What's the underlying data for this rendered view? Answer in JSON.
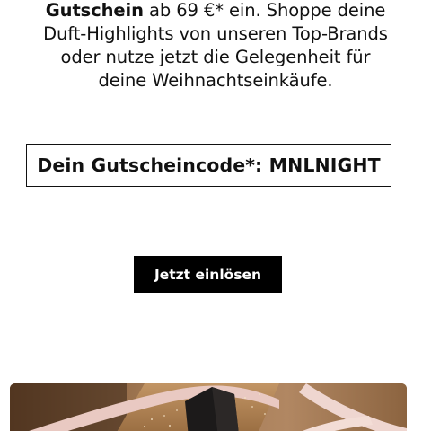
{
  "promo_text": {
    "line1_bold": "Gutschein",
    "line1_rest": " ab 69 €* ein. Shoppe deine",
    "line2": "Duft-Highlights von unseren Top-Brands",
    "line3": "oder nutze jetzt die Gelegenheit für",
    "line4": "deine Weihnachtseinkäufe."
  },
  "voucher": {
    "code_text": "Dein Gutscheincode*: MNLNIGHT"
  },
  "cta": {
    "label": "Jetzt einlösen"
  },
  "colors": {
    "text": "#111111",
    "button_bg": "#000000",
    "button_text": "#ffffff",
    "hero_brown": "#9a7048"
  },
  "hero_image": {
    "icon": "gift-ribbon-image"
  }
}
